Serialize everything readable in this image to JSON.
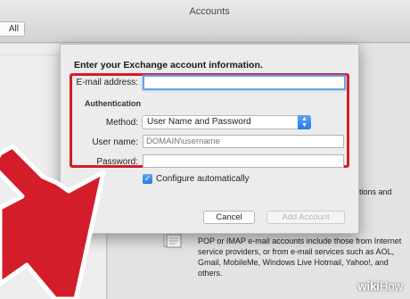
{
  "window": {
    "title": "Accounts",
    "toolbar_button": "All"
  },
  "background_text": {
    "right_snippet": "orations and",
    "pop_description": "POP or IMAP e-mail accounts include those from Internet service providers, or from e-mail services such as AOL, Gmail, MobileMe, Windows Live Hotmail, Yahoo!, and others."
  },
  "dialog": {
    "heading": "Enter your Exchange account information.",
    "email_label": "E-mail address:",
    "email_value": "",
    "auth_heading": "Authentication",
    "method_label": "Method:",
    "method_value": "User Name and Password",
    "username_label": "User name:",
    "username_placeholder": "DOMAIN\\username",
    "password_label": "Password:",
    "password_value": "",
    "configure_label": "Configure automatically",
    "configure_checked": true,
    "cancel_label": "Cancel",
    "add_account_label": "Add Account"
  },
  "colors": {
    "highlight": "#d31d2a",
    "arrow": "#d31d2a",
    "focus_ring": "#6aa3e5",
    "accent_blue": "#2a78ec"
  },
  "watermark": {
    "brand_part1": "wiki",
    "brand_part2": "How"
  }
}
